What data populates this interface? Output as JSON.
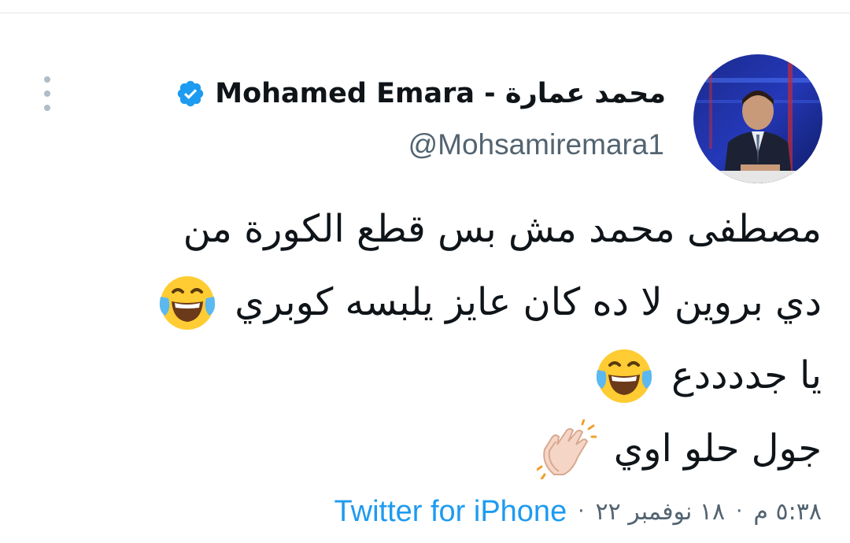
{
  "tweet": {
    "author": {
      "display_name": "Mohamed Emara - محمد عمارة",
      "handle": "@Mohsamiremara1",
      "verified": true,
      "verified_color": "#1d9bf0"
    },
    "lines": [
      {
        "text": "مصطفى محمد مش بس قطع الكورة من",
        "emoji": null
      },
      {
        "text": "دي بروين لا ده كان عايز يلبسه كوبري",
        "emoji": "face-with-tears-of-joy-icon"
      },
      {
        "text": "يا جددددع",
        "emoji": "face-with-tears-of-joy-icon"
      },
      {
        "text": "جول حلو اوي",
        "emoji": "clapping-hands-icon"
      }
    ],
    "meta": {
      "time": "٥:٣٨ م",
      "date": "١٨ نوفمبر ٢٢",
      "separator": "·",
      "source": "Twitter for iPhone"
    }
  },
  "colors": {
    "text": "#0f1419",
    "secondary": "#536471",
    "link": "#1d9bf0",
    "divider": "#e1e6ea"
  }
}
